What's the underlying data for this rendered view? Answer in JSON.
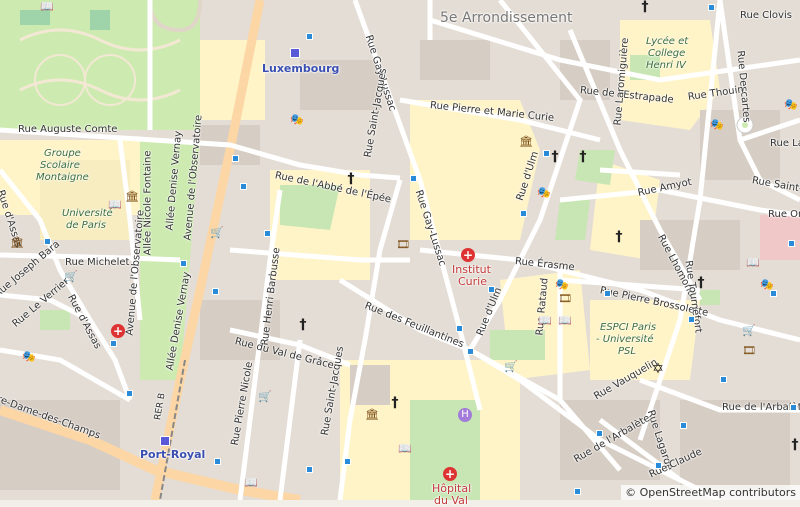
{
  "map": {
    "area_label": "5e Arrondissement",
    "streets": {
      "auguste_comte": "Rue Auguste Comte",
      "gay_lussac_n": "Rue Gay-Lussac",
      "gay_lussac_s": "Rue Gay-Lussac",
      "pierre_marie_curie": "Rue Pierre et Marie Curie",
      "estrapade": "Rue de l'Estrapade",
      "clovis": "Rue Clovis",
      "descartes": "Rue Descartes",
      "thouin": "Rue Thouin",
      "laromiguiere": "Rue Laromiguière",
      "amyot": "Rue Amyot",
      "abbe_epee": "Rue de l'Abbé de l'Épée",
      "saint_jacques_n": "Rue Saint-Jacques",
      "saint_jacques_s": "Rue Saint-Jacques",
      "ulm_n": "Rue d'Ulm",
      "ulm_s": "Rue d'Ulm",
      "erasme": "Rue Érasme",
      "pierre_brossolette": "Rue Pierre Brossolette",
      "lhomond": "Rue Lhomond",
      "tournefort": "Rue Tournefort",
      "michelet": "Rue Michelet",
      "observatoire": "Avenue de l'Observatoire",
      "assas_n": "Rue d'Assas",
      "assas_s": "Rue d'Assas",
      "joseph_bara": "Rue Joseph Bara",
      "le_verrier": "Rue Le Verrier",
      "champs": "Rue Notre-Dame-des-Champs",
      "nicole_fontaine": "Allée Nicole Fontaine",
      "denise_vernay_n": "Allée Denise Vernay",
      "denise_vernay_s": "Allée Denise Vernay",
      "henri_barbusse": "Rue Henri Barbusse",
      "val_de_grace": "Rue du Val de Grâce",
      "feuillantines": "Rue des Feuillantines",
      "pierre_nicole": "Rue Pierre Nicole",
      "ratault": "Rue Rataud",
      "vauquelin": "Rue Vauquelin",
      "lagarde": "Rue Lagarde",
      "arbalete_e": "Rue de l'Arbalète",
      "arbalete_s": "Rue de l'Arbalète",
      "claude": "Rue Claude",
      "lacepede": "Rue Lacé",
      "saint_m": "Rue Saint-M",
      "ortolan": "Rue Ort",
      "rer": "RER B"
    },
    "places": {
      "luxembourg": "Luxembourg",
      "port_royal": "Port-Royal",
      "institut_curie_1": "Institut",
      "institut_curie_2": "Curie",
      "hopital_1": "Hôpital",
      "hopital_2": "du Val",
      "groupe_1": "Groupe",
      "groupe_2": "Scolaire",
      "groupe_3": "Montaigne",
      "univ_1": "Université",
      "univ_2": "de Paris",
      "lycee_1": "Lycée et",
      "lycee_2": "College",
      "lycee_3": "Henri IV",
      "espci_1": "ESPCI Paris",
      "espci_2": "- Université",
      "espci_3": "PSL"
    },
    "attribution": "© OpenStreetMap contributors"
  },
  "colors": {
    "background": "#f2efe9",
    "park": "#cdebb0",
    "garden": "#c8e6b4",
    "building": "#d9d0c9",
    "school": "#fff4c7",
    "road_main": "#fcd6a4",
    "road": "#ffffff",
    "rail": "#999999"
  }
}
